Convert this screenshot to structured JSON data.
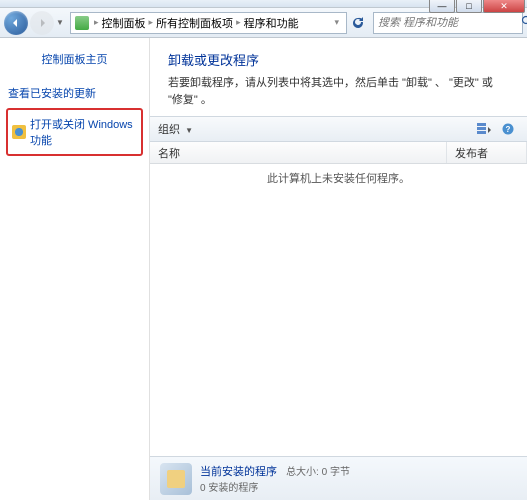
{
  "window": {
    "min": "—",
    "max": "□",
    "close": "✕"
  },
  "breadcrumb": {
    "items": [
      "控制面板",
      "所有控制面板项",
      "程序和功能"
    ]
  },
  "search": {
    "placeholder": "搜索 程序和功能"
  },
  "sidebar": {
    "home": "控制面板主页",
    "updates": "查看已安装的更新",
    "winfeatures": "打开或关闭 Windows 功能"
  },
  "main": {
    "heading": "卸载或更改程序",
    "subtext": "若要卸载程序，请从列表中将其选中，然后单击 \"卸载\" 、 \"更改\" 或 \"修复\" 。"
  },
  "toolbar": {
    "organize": "组织"
  },
  "columns": {
    "name": "名称",
    "publisher": "发布者"
  },
  "list": {
    "empty": "此计算机上未安装任何程序。"
  },
  "status": {
    "title": "当前安装的程序",
    "meta": "总大小: 0 字节",
    "line2": "0 安装的程序"
  }
}
